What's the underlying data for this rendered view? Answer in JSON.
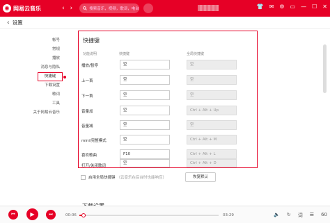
{
  "app": {
    "logo_char": "◉",
    "name": "网易云音乐"
  },
  "search": {
    "placeholder": "搜索音乐，视频，歌词，电台"
  },
  "subheader": {
    "title": "设置"
  },
  "sidebar": {
    "items": [
      {
        "label": "帐号"
      },
      {
        "label": "常规"
      },
      {
        "label": "播放"
      },
      {
        "label": "消息与隐私"
      },
      {
        "label": "快捷键",
        "active": true
      },
      {
        "label": "下载设置"
      },
      {
        "label": "歌词"
      },
      {
        "label": "工具"
      },
      {
        "label": "关于网易云音乐"
      }
    ]
  },
  "shortcuts": {
    "title": "快捷键",
    "col_function": "功能说明",
    "col_shortcut": "快捷键",
    "col_global": "全局快捷键",
    "rows": [
      {
        "label": "播放/暂停",
        "key": "空",
        "global": "空"
      },
      {
        "label": "上一首",
        "key": "空",
        "global": "空"
      },
      {
        "label": "下一首",
        "key": "空",
        "global": "空"
      },
      {
        "label": "音量加",
        "key": "空",
        "global": "Ctrl + Alt + Up"
      },
      {
        "label": "音量减",
        "key": "空",
        "global": "空"
      },
      {
        "label": "mini/完整模式",
        "key": "空",
        "global": "Ctrl + Alt + M"
      },
      {
        "label": "喜欢歌曲",
        "key": "F10",
        "global": "Ctrl + Alt + L"
      },
      {
        "label": "打开/关闭歌词",
        "key": "空",
        "global": "Ctrl + Alt + D"
      }
    ],
    "enable_global": "启用全局快捷键",
    "enable_global_hint": "（云音乐在后台时也能响应）",
    "restore_default": "恢复默认"
  },
  "section2": {
    "title": "下载设置"
  },
  "player": {
    "current_time": "00:06",
    "total_time": "03:29",
    "progress": 0.03,
    "volume_level": "60"
  },
  "colors": {
    "brand": "#e60026"
  }
}
